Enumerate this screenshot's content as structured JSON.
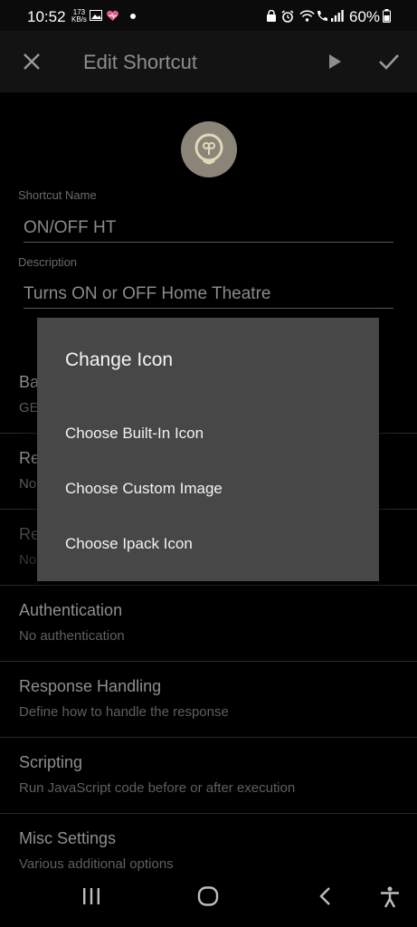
{
  "status_bar": {
    "time": "10:52",
    "net_speed_value": "173",
    "net_speed_unit": "KB/s",
    "battery": "60%"
  },
  "app_bar": {
    "title": "Edit Shortcut"
  },
  "form": {
    "name_label": "Shortcut Name",
    "name_value": "ON/OFF HT",
    "description_label": "Description",
    "description_value": "Turns ON or OFF Home Theatre"
  },
  "settings": [
    {
      "title": "Ba",
      "subtitle": "GE"
    },
    {
      "title": "Re",
      "subtitle": "No"
    },
    {
      "title": "Re",
      "subtitle": "No"
    },
    {
      "title": "Authentication",
      "subtitle": "No authentication"
    },
    {
      "title": "Response Handling",
      "subtitle": "Define how to handle the response"
    },
    {
      "title": "Scripting",
      "subtitle": "Run JavaScript code before or after execution"
    },
    {
      "title": "Misc Settings",
      "subtitle": "Various additional options"
    }
  ],
  "dialog": {
    "title": "Change Icon",
    "options": [
      "Choose Built-In Icon",
      "Choose Custom Image",
      "Choose Ipack Icon"
    ]
  },
  "colors": {
    "background": "#000000",
    "dialog": "#474747",
    "app_bar": "#131313"
  }
}
